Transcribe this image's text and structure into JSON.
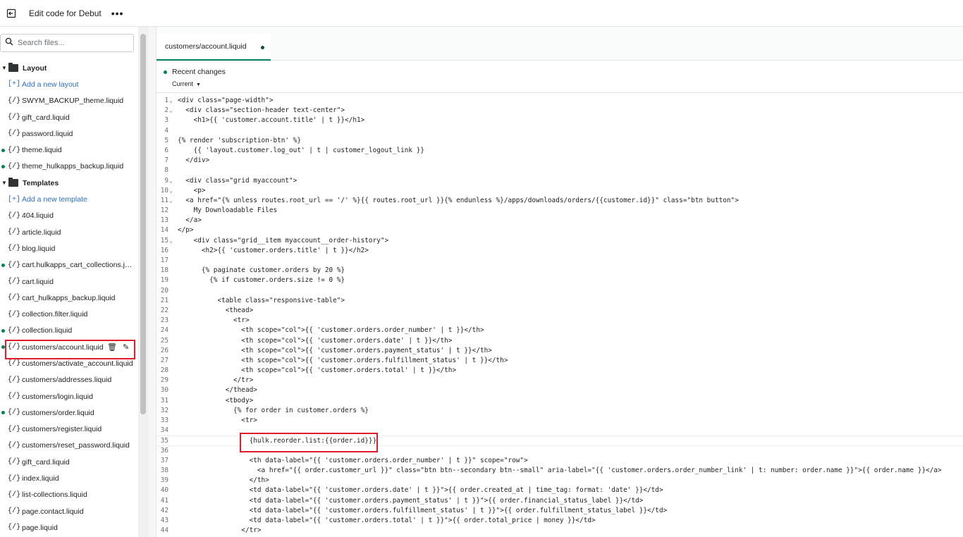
{
  "topbar": {
    "title": "Edit code for Debut",
    "more": "•••"
  },
  "search": {
    "placeholder": "Search files..."
  },
  "tree": {
    "layout": {
      "label": "Layout",
      "add_label": "Add a new layout",
      "files": [
        {
          "label": "SWYM_BACKUP_theme.liquid",
          "mod": false
        },
        {
          "label": "gift_card.liquid",
          "mod": false
        },
        {
          "label": "password.liquid",
          "mod": false
        },
        {
          "label": "theme.liquid",
          "mod": true
        },
        {
          "label": "theme_hulkapps_backup.liquid",
          "mod": true
        }
      ]
    },
    "templates": {
      "label": "Templates",
      "add_label": "Add a new template",
      "files": [
        {
          "label": "404.liquid",
          "mod": false
        },
        {
          "label": "article.liquid",
          "mod": false
        },
        {
          "label": "blog.liquid",
          "mod": false
        },
        {
          "label": "cart.hulkapps_cart_collections.jso...",
          "mod": true
        },
        {
          "label": "cart.liquid",
          "mod": false
        },
        {
          "label": "cart_hulkapps_backup.liquid",
          "mod": false
        },
        {
          "label": "collection.filter.liquid",
          "mod": false
        },
        {
          "label": "collection.liquid",
          "mod": true
        },
        {
          "label": "customers/account.liquid",
          "mod": true,
          "active": true
        },
        {
          "label": "customers/activate_account.liquid",
          "mod": false
        },
        {
          "label": "customers/addresses.liquid",
          "mod": false
        },
        {
          "label": "customers/login.liquid",
          "mod": false
        },
        {
          "label": "customers/order.liquid",
          "mod": true
        },
        {
          "label": "customers/register.liquid",
          "mod": false
        },
        {
          "label": "customers/reset_password.liquid",
          "mod": false
        },
        {
          "label": "gift_card.liquid",
          "mod": false
        },
        {
          "label": "index.liquid",
          "mod": false
        },
        {
          "label": "list-collections.liquid",
          "mod": false
        },
        {
          "label": "page.contact.liquid",
          "mod": false
        },
        {
          "label": "page.liquid",
          "mod": false
        }
      ]
    }
  },
  "file_icon": "{/}",
  "editor": {
    "tab_label": "customers/account.liquid",
    "recent_title": "Recent changes",
    "recent_select": "Current",
    "lines": [
      {
        "n": "1",
        "fold": true,
        "t": "<div class=\"page-width\">"
      },
      {
        "n": "2",
        "fold": true,
        "t": "  <div class=\"section-header text-center\">"
      },
      {
        "n": "3",
        "fold": false,
        "t": "    <h1>{{ 'customer.account.title' | t }}</h1>"
      },
      {
        "n": "4",
        "fold": false,
        "t": ""
      },
      {
        "n": "5",
        "fold": false,
        "t": "{% render 'subscription-btn' %}"
      },
      {
        "n": "6",
        "fold": false,
        "t": "    {{ 'layout.customer.log_out' | t | customer_logout_link }}"
      },
      {
        "n": "7",
        "fold": false,
        "t": "  </div>"
      },
      {
        "n": "8",
        "fold": false,
        "t": ""
      },
      {
        "n": "9",
        "fold": true,
        "t": "  <div class=\"grid myaccount\">"
      },
      {
        "n": "10",
        "fold": true,
        "t": "    <p>"
      },
      {
        "n": "11",
        "fold": true,
        "t": "  <a href=\"{% unless routes.root_url == '/' %}{{ routes.root_url }}{% endunless %}/apps/downloads/orders/{{customer.id}}\" class=\"btn button\">"
      },
      {
        "n": "12",
        "fold": false,
        "t": "    My Downloadable Files"
      },
      {
        "n": "13",
        "fold": false,
        "t": "  </a>"
      },
      {
        "n": "14",
        "fold": false,
        "t": "</p>"
      },
      {
        "n": "15",
        "fold": true,
        "t": "    <div class=\"grid__item myaccount__order-history\">"
      },
      {
        "n": "16",
        "fold": false,
        "t": "      <h2>{{ 'customer.orders.title' | t }}</h2>"
      },
      {
        "n": "17",
        "fold": false,
        "t": ""
      },
      {
        "n": "18",
        "fold": false,
        "t": "      {% paginate customer.orders by 20 %}"
      },
      {
        "n": "19",
        "fold": false,
        "t": "        {% if customer.orders.size != 0 %}"
      },
      {
        "n": "20",
        "fold": false,
        "t": ""
      },
      {
        "n": "21",
        "fold": false,
        "t": "          <table class=\"responsive-table\">"
      },
      {
        "n": "22",
        "fold": false,
        "t": "            <thead>"
      },
      {
        "n": "23",
        "fold": false,
        "t": "              <tr>"
      },
      {
        "n": "24",
        "fold": false,
        "t": "                <th scope=\"col\">{{ 'customer.orders.order_number' | t }}</th>"
      },
      {
        "n": "25",
        "fold": false,
        "t": "                <th scope=\"col\">{{ 'customer.orders.date' | t }}</th>"
      },
      {
        "n": "26",
        "fold": false,
        "t": "                <th scope=\"col\">{{ 'customer.orders.payment_status' | t }}</th>"
      },
      {
        "n": "27",
        "fold": false,
        "t": "                <th scope=\"col\">{{ 'customer.orders.fulfillment_status' | t }}</th>"
      },
      {
        "n": "28",
        "fold": false,
        "t": "                <th scope=\"col\">{{ 'customer.orders.total' | t }}</th>"
      },
      {
        "n": "29",
        "fold": false,
        "t": "              </tr>"
      },
      {
        "n": "30",
        "fold": false,
        "t": "            </thead>"
      },
      {
        "n": "31",
        "fold": false,
        "t": "            <tbody>"
      },
      {
        "n": "32",
        "fold": false,
        "t": "              {% for order in customer.orders %}"
      },
      {
        "n": "33",
        "fold": false,
        "t": "                <tr>"
      },
      {
        "n": "34",
        "fold": false,
        "t": ""
      },
      {
        "n": "35",
        "fold": false,
        "t": "                  {hulk.reorder.list:{{order.id}}}",
        "cur": true
      },
      {
        "n": "36",
        "fold": false,
        "t": ""
      },
      {
        "n": "37",
        "fold": false,
        "t": "                  <th data-label=\"{{ 'customer.orders.order_number' | t }}\" scope=\"row\">"
      },
      {
        "n": "38",
        "fold": false,
        "t": "                    <a href=\"{{ order.customer_url }}\" class=\"btn btn--secondary btn--small\" aria-label=\"{{ 'customer.orders.order_number_link' | t: number: order.name }}\">{{ order.name }}</a>"
      },
      {
        "n": "39",
        "fold": false,
        "t": "                  </th>"
      },
      {
        "n": "40",
        "fold": false,
        "t": "                  <td data-label=\"{{ 'customer.orders.date' | t }}\">{{ order.created_at | time_tag: format: 'date' }}</td>"
      },
      {
        "n": "41",
        "fold": false,
        "t": "                  <td data-label=\"{{ 'customer.orders.payment_status' | t }}\">{{ order.financial_status_label }}</td>"
      },
      {
        "n": "42",
        "fold": false,
        "t": "                  <td data-label=\"{{ 'customer.orders.fulfillment_status' | t }}\">{{ order.fulfillment_status_label }}</td>"
      },
      {
        "n": "43",
        "fold": false,
        "t": "                  <td data-label=\"{{ 'customer.orders.total' | t }}\">{{ order.total_price | money }}</td>"
      },
      {
        "n": "44",
        "fold": false,
        "t": "                </tr>"
      }
    ]
  },
  "colors": {
    "accent": "#008060",
    "link": "#2c6ecb",
    "annotation": "#e11d2b"
  }
}
